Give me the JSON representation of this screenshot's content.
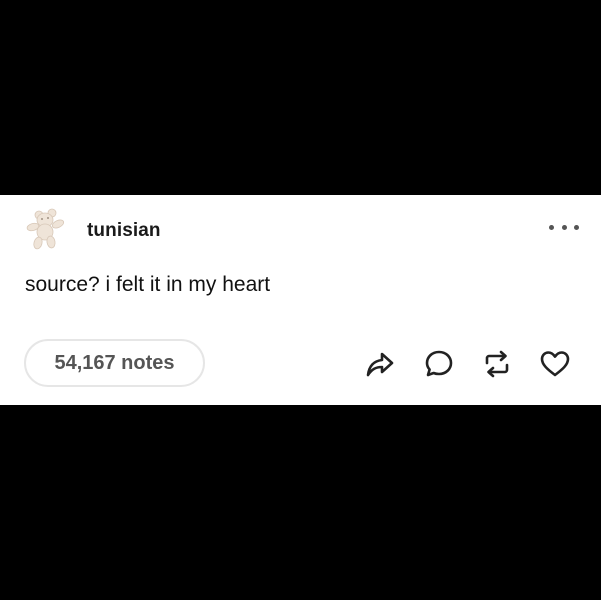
{
  "post": {
    "username": "tunisian",
    "body": "source? i felt it in my heart",
    "notes_label": "54,167 notes"
  },
  "icons": {
    "avatar": "teddy-bear-avatar",
    "more": "ellipsis-icon",
    "share": "share-arrow-icon",
    "reply": "speech-bubble-icon",
    "reblog": "reblog-icon",
    "like": "heart-icon"
  },
  "colors": {
    "background": "#000000",
    "card": "#ffffff",
    "text": "#111111",
    "muted": "#555555",
    "pill_border": "#e6e6e6"
  }
}
